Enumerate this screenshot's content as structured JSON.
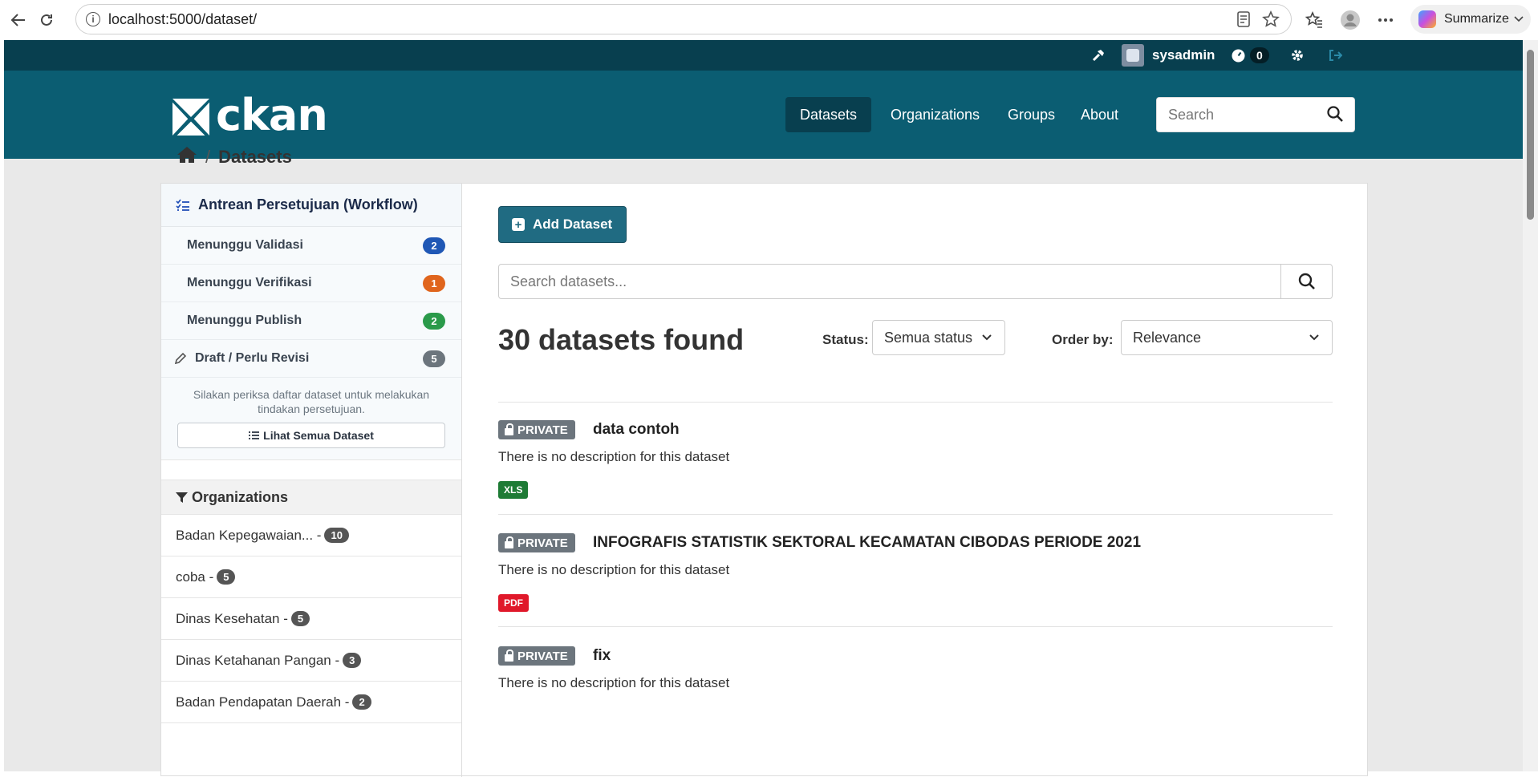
{
  "browser": {
    "url": "localhost:5000/dataset/",
    "summarize_label": "Summarize"
  },
  "topbar": {
    "username": "sysadmin",
    "activity_count": "0"
  },
  "header": {
    "logo_text": "ckan",
    "nav": [
      {
        "label": "Datasets",
        "active": true
      },
      {
        "label": "Organizations",
        "active": false
      },
      {
        "label": "Groups",
        "active": false
      },
      {
        "label": "About",
        "active": false
      }
    ],
    "search_placeholder": "Search"
  },
  "breadcrumb": {
    "current": "Datasets"
  },
  "workflow": {
    "title": "Antrean Persetujuan (Workflow)",
    "items": [
      {
        "label": "Menunggu Validasi",
        "count": "2",
        "color": "#1f57b5"
      },
      {
        "label": "Menunggu Verifikasi",
        "count": "1",
        "color": "#e0651d"
      },
      {
        "label": "Menunggu Publish",
        "count": "2",
        "color": "#2a9a4a"
      },
      {
        "label": "Draft / Perlu Revisi",
        "count": "5",
        "color": "#6c757d"
      }
    ],
    "note": "Silakan periksa daftar dataset untuk melakukan tindakan persetujuan.",
    "view_all_label": "Lihat Semua Dataset"
  },
  "facets": {
    "title": "Organizations",
    "items": [
      {
        "label": "Badan Kepegawaian... -",
        "count": "10"
      },
      {
        "label": "coba -",
        "count": "5"
      },
      {
        "label": "Dinas Kesehatan -",
        "count": "5"
      },
      {
        "label": "Dinas Ketahanan Pangan -",
        "count": "3"
      },
      {
        "label": "Badan Pendapatan Daerah -",
        "count": "2"
      }
    ]
  },
  "content": {
    "add_button": "Add Dataset",
    "search_placeholder": "Search datasets...",
    "found_text": "30 datasets found",
    "status_label": "Status:",
    "status_value": "Semua status",
    "order_label": "Order by:",
    "order_value": "Relevance",
    "datasets": [
      {
        "badge": "PRIVATE",
        "title": "data contoh",
        "description": "There is no description for this dataset",
        "format": "XLS",
        "format_color": "#1e7b35"
      },
      {
        "badge": "PRIVATE",
        "title": "INFOGRAFIS STATISTIK SEKTORAL KECAMATAN CIBODAS PERIODE 2021",
        "description": "There is no description for this dataset",
        "format": "PDF",
        "format_color": "#e0182a"
      },
      {
        "badge": "PRIVATE",
        "title": "fix",
        "description": "There is no description for this dataset",
        "format": "",
        "format_color": ""
      }
    ]
  }
}
